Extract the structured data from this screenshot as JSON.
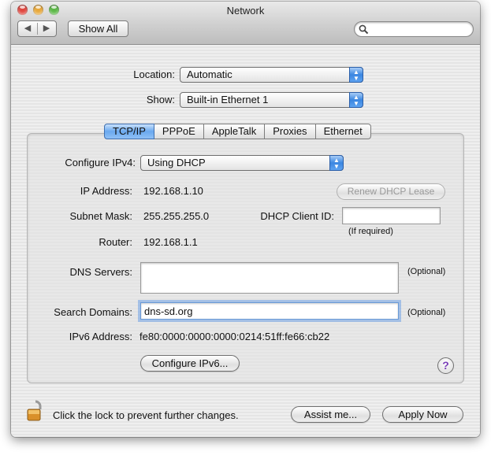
{
  "window": {
    "title": "Network",
    "show_all_label": "Show All",
    "nav_back_glyph": "◀",
    "nav_forward_glyph": "▶",
    "search": {
      "value": "",
      "placeholder": ""
    }
  },
  "top": {
    "location_label": "Location:",
    "location_value": "Automatic",
    "show_label": "Show:",
    "show_value": "Built-in Ethernet 1"
  },
  "tabs": [
    {
      "label": "TCP/IP",
      "active": true
    },
    {
      "label": "PPPoE",
      "active": false
    },
    {
      "label": "AppleTalk",
      "active": false
    },
    {
      "label": "Proxies",
      "active": false
    },
    {
      "label": "Ethernet",
      "active": false
    }
  ],
  "tcpip": {
    "configure_label": "Configure IPv4:",
    "configure_value": "Using DHCP",
    "ip_label": "IP Address:",
    "ip_value": "192.168.1.10",
    "renew_label": "Renew DHCP Lease",
    "subnet_label": "Subnet Mask:",
    "subnet_value": "255.255.255.0",
    "client_id_label": "DHCP Client ID:",
    "client_id_value": "",
    "if_required": "(If required)",
    "router_label": "Router:",
    "router_value": "192.168.1.1",
    "dns_label": "DNS Servers:",
    "dns_value": "",
    "optional_dns": "(Optional)",
    "search_domains_label": "Search Domains:",
    "search_domains_value": "dns-sd.org",
    "optional_search": "(Optional)",
    "ipv6_label": "IPv6 Address:",
    "ipv6_value": "fe80:0000:0000:0000:0214:51ff:fe66:cb22",
    "configure_ipv6_label": "Configure IPv6...",
    "help_glyph": "?"
  },
  "footer": {
    "lock_text": "Click the lock to prevent further changes.",
    "assist_label": "Assist me...",
    "apply_label": "Apply Now"
  },
  "colors": {
    "accent_blue": "#3a86e1",
    "close": "#e0473f",
    "minimize": "#e8a83a",
    "zoom": "#5cb847"
  }
}
